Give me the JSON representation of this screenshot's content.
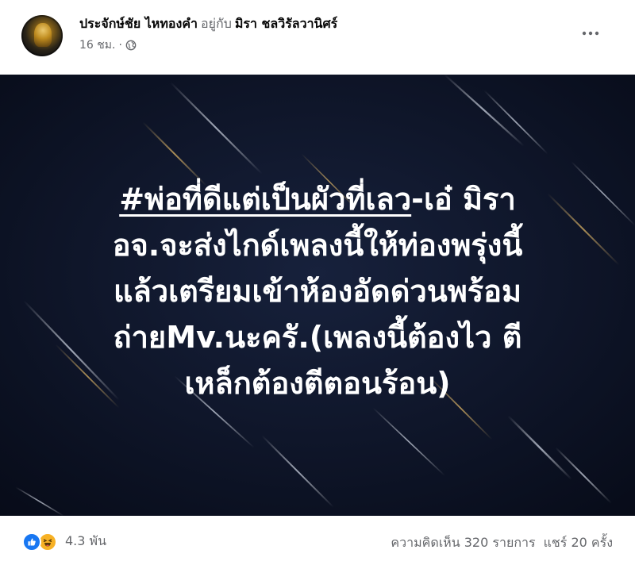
{
  "post": {
    "author": "ประจักษ์ชัย ไหทองคำ",
    "with_text": "อยู่กับ",
    "tagged": "มิรา ชลวิรัลวานิศร์",
    "time": "16 ชม.",
    "dot": "·",
    "privacy_icon": "globe-icon",
    "more_icon": "more-horizontal-icon"
  },
  "media": {
    "hashtag": "#พ่อที่ดีแต่เป็นผัวที่เลว",
    "line1_rest": "-เอ๋ มิรา",
    "line2": "อจ.จะส่งไกด์เพลงนี้ให้ท่องพรุ่งนี้",
    "line3": "แล้วเตรียมเข้าห้องอัดด่วนพร้อม",
    "line4": "ถ่ายMv.นะครั.(เพลงนี้ต้องไว ตี",
    "line5": "เหล็กต้องตีตอนร้อน)",
    "background_color": "#0d1426",
    "text_color": "#ffffff"
  },
  "footer": {
    "reaction_icons": [
      "like-icon",
      "haha-icon"
    ],
    "reaction_count": "4.3 พัน",
    "comments": "ความคิดเห็น 320 รายการ",
    "shares": "แชร์ 20 ครั้ง"
  },
  "colors": {
    "like": "#1877f2",
    "haha": "#f7b125",
    "secondary_text": "#65676b"
  }
}
